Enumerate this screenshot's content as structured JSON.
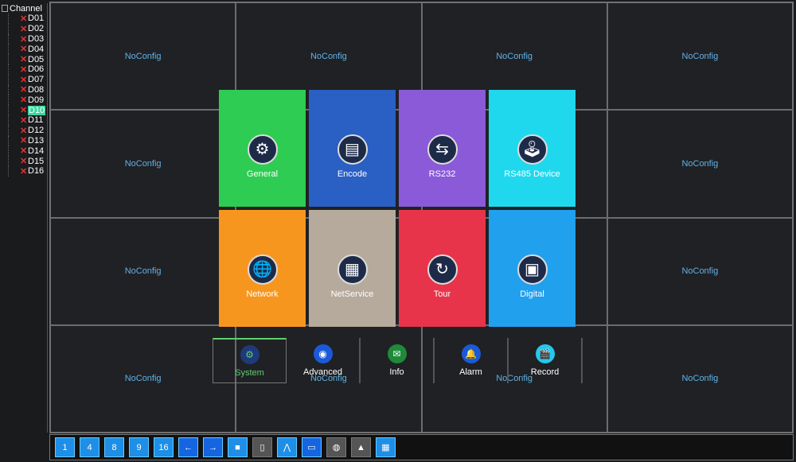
{
  "tree": {
    "root": "Channel",
    "channels": [
      "D01",
      "D02",
      "D03",
      "D04",
      "D05",
      "D06",
      "D07",
      "D08",
      "D09",
      "D10",
      "D11",
      "D12",
      "D13",
      "D14",
      "D15",
      "D16"
    ],
    "selected": "D10"
  },
  "grid": {
    "cell_label": "NoConfig",
    "cells": 16
  },
  "menu": {
    "tiles": [
      {
        "label": "General",
        "color": "#2ecc52",
        "icon": "gears-icon",
        "glyph": "⚙"
      },
      {
        "label": "Encode",
        "color": "#2a5fc4",
        "icon": "encode-icon",
        "glyph": "▤"
      },
      {
        "label": "RS232",
        "color": "#8a5ad8",
        "icon": "rs232-arrows-icon",
        "glyph": "⇆"
      },
      {
        "label": "RS485 Device",
        "color": "#1fd8ee",
        "icon": "joystick-icon",
        "glyph": "🕹"
      },
      {
        "label": "Network",
        "color": "#f7961e",
        "icon": "globe-icon",
        "glyph": "🌐"
      },
      {
        "label": "NetService",
        "color": "#b5aa9c",
        "icon": "netservice-icon",
        "glyph": "▦"
      },
      {
        "label": "Tour",
        "color": "#e8344a",
        "icon": "refresh-icon",
        "glyph": "↻"
      },
      {
        "label": "Digital",
        "color": "#21a0ee",
        "icon": "digital-monitors-icon",
        "glyph": "▣"
      }
    ]
  },
  "tabs": [
    {
      "label": "System",
      "icon": "system-gears-icon",
      "glyph": "⚙",
      "color": "#1e3a7a",
      "active": true
    },
    {
      "label": "Advanced",
      "icon": "camera-icon",
      "glyph": "◉",
      "color": "#1a5ad8",
      "active": false
    },
    {
      "label": "Info",
      "icon": "info-icon",
      "glyph": "✉",
      "color": "#1f8a3a",
      "active": false
    },
    {
      "label": "Alarm",
      "icon": "alarm-bell-icon",
      "glyph": "🔔",
      "color": "#1a5ad8",
      "active": false
    },
    {
      "label": "Record",
      "icon": "clapper-icon",
      "glyph": "🎬",
      "color": "#24c8ee",
      "active": false
    }
  ],
  "toolbar": [
    {
      "name": "layout-1-button",
      "label": "1"
    },
    {
      "name": "layout-4-button",
      "label": "4"
    },
    {
      "name": "layout-8-button",
      "label": "8"
    },
    {
      "name": "layout-9-button",
      "label": "9"
    },
    {
      "name": "layout-16-button",
      "label": "16"
    },
    {
      "name": "prev-button",
      "label": "←"
    },
    {
      "name": "next-button",
      "label": "→"
    },
    {
      "name": "fullscreen-button",
      "label": "■"
    },
    {
      "name": "ptz-button",
      "label": "▯"
    },
    {
      "name": "chart-button",
      "label": "⋀"
    },
    {
      "name": "monitor-button",
      "label": "▭"
    },
    {
      "name": "globe-button",
      "label": "◍"
    },
    {
      "name": "user-button",
      "label": "▲"
    },
    {
      "name": "qr-button",
      "label": "▦"
    }
  ]
}
